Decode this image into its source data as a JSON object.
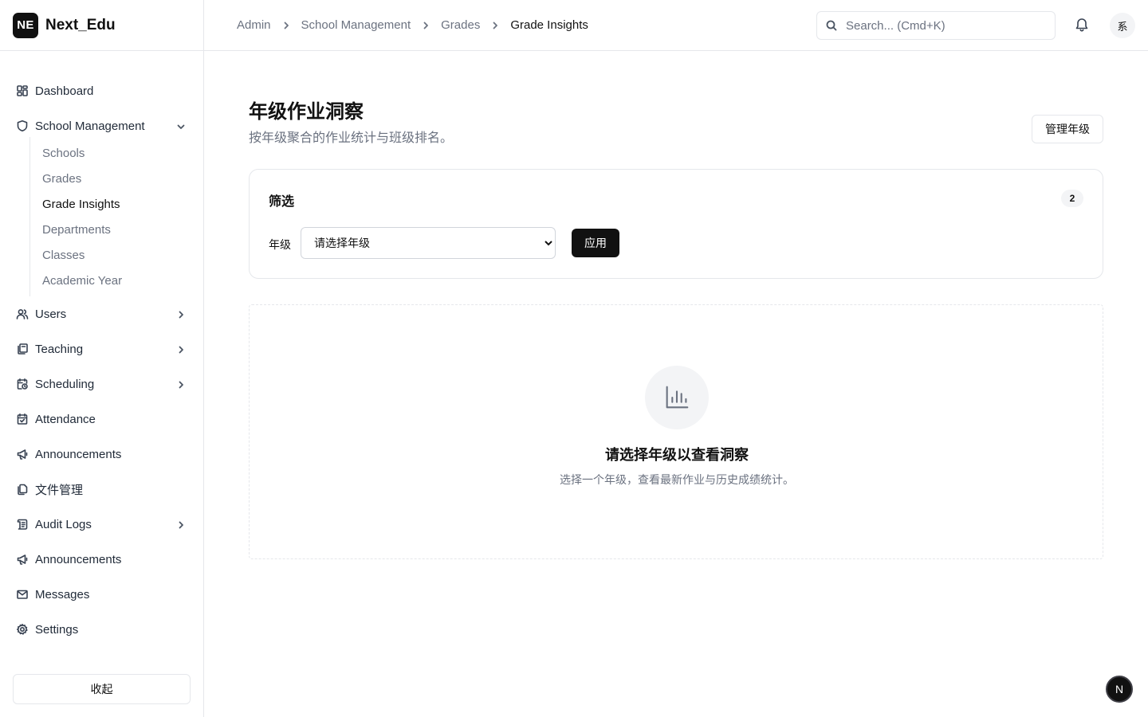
{
  "brand": {
    "logo": "NE",
    "name": "Next_Edu"
  },
  "sidebar": {
    "items": [
      {
        "label": "Dashboard",
        "icon": "dashboard-icon"
      },
      {
        "label": "School Management",
        "icon": "shield-icon",
        "expanded": true,
        "children": [
          "Schools",
          "Grades",
          "Grade Insights",
          "Departments",
          "Classes",
          "Academic Year"
        ],
        "active_child": "Grade Insights"
      },
      {
        "label": "Users",
        "icon": "users-icon"
      },
      {
        "label": "Teaching",
        "icon": "book-icon"
      },
      {
        "label": "Scheduling",
        "icon": "calendar-clock-icon"
      },
      {
        "label": "Attendance",
        "icon": "calendar-check-icon"
      },
      {
        "label": "Announcements",
        "icon": "megaphone-icon"
      },
      {
        "label": "文件管理",
        "icon": "files-icon"
      },
      {
        "label": "Audit Logs",
        "icon": "scroll-icon"
      },
      {
        "label": "Announcements",
        "icon": "megaphone-icon"
      },
      {
        "label": "Messages",
        "icon": "mail-icon"
      },
      {
        "label": "Settings",
        "icon": "gear-icon"
      }
    ],
    "collapse_label": "收起"
  },
  "topbar": {
    "breadcrumb": [
      "Admin",
      "School Management",
      "Grades",
      "Grade Insights"
    ],
    "search_placeholder": "Search... (Cmd+K)",
    "avatar_text": "系"
  },
  "main": {
    "title": "年级作业洞察",
    "subtitle": "按年级聚合的作业统计与班级排名。",
    "manage_button": "管理年级",
    "filter": {
      "title": "筛选",
      "badge": "2",
      "grade_label": "年级",
      "grade_select_value": "请选择年级",
      "apply_label": "应用"
    },
    "empty_state": {
      "icon": "bar-chart-icon",
      "title": "请选择年级以查看洞察",
      "description": "选择一个年级，查看最新作业与历史成绩统计。"
    }
  },
  "next_badge": "N"
}
